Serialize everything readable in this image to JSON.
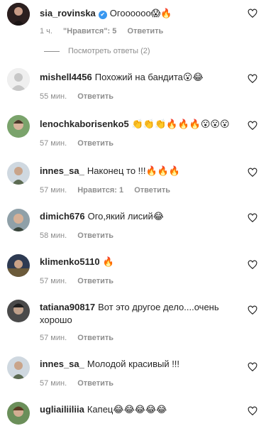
{
  "comments": [
    {
      "user": "sia_rovinska",
      "verified": true,
      "text": "Огоооооо",
      "emoji": "😱🔥",
      "time": "1 ч.",
      "likes": "\"Нравится\": 5",
      "reply": "Ответить"
    },
    {
      "user": "mishell4456",
      "text": "Похожий на бандита",
      "emoji": "😮😂",
      "time": "55 мин.",
      "reply": "Ответить"
    },
    {
      "user": "lenochkaborisenko5",
      "text": "",
      "emoji": "👏👏👏🔥🔥🔥😮😮😮",
      "time": "57 мин.",
      "reply": "Ответить"
    },
    {
      "user": "innes_sa_",
      "text": "Наконец то !!!",
      "emoji": "🔥🔥🔥",
      "time": "57 мин.",
      "likes": "Нравится: 1",
      "reply": "Ответить"
    },
    {
      "user": "dimich676",
      "text": "Ого,який лисий",
      "emoji": "😂",
      "time": "58 мин.",
      "reply": "Ответить"
    },
    {
      "user": "klimenko5110",
      "text": "",
      "emoji": "🔥",
      "time": "57 мин.",
      "reply": "Ответить"
    },
    {
      "user": "tatiana90817",
      "text": "Вот это другое дело....очень хорошо",
      "emoji": "",
      "time": "57 мин.",
      "reply": "Ответить"
    },
    {
      "user": "innes_sa_",
      "text": "Молодой красивый !!!",
      "emoji": "",
      "time": "57 мин.",
      "reply": "Ответить"
    },
    {
      "user": "ugliailiiliia",
      "text": "Капец",
      "emoji": "😂😂😂😂😂",
      "time": "",
      "reply": ""
    }
  ],
  "view_replies": "Посмотреть ответы (2)",
  "icons": {
    "like": "heart-outline-icon",
    "verified": "verified-badge-icon"
  },
  "colors": {
    "text": "#262626",
    "muted": "#8e8e8e",
    "verified": "#3897f0"
  }
}
